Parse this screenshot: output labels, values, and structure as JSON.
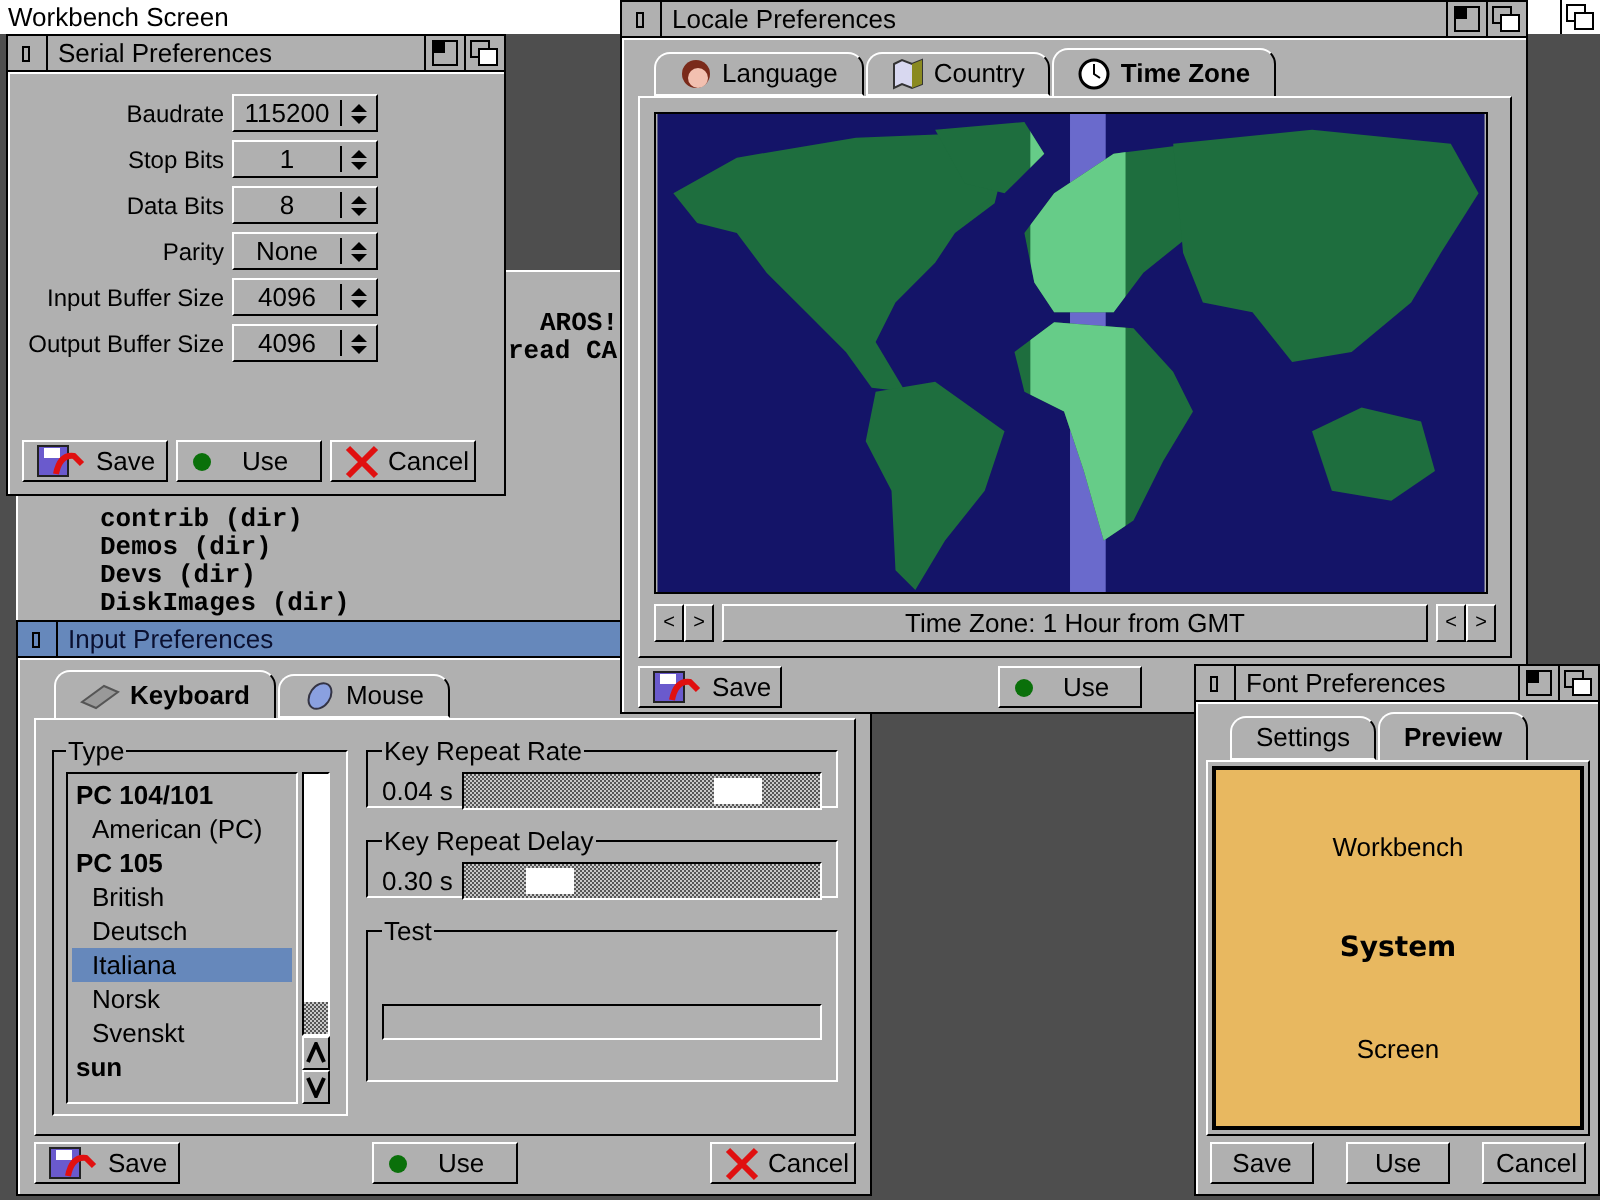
{
  "screen": {
    "title": "Workbench Screen"
  },
  "shell": {
    "lines_right": [
      "AROS!",
      "read CA"
    ],
    "lines": [
      "contrib (dir)",
      "Demos (dir)",
      "Devs (dir)",
      "DiskImages (dir)"
    ]
  },
  "serial": {
    "title": "Serial Preferences",
    "active": false,
    "fields": [
      {
        "label": "Baudrate",
        "value": "115200"
      },
      {
        "label": "Stop Bits",
        "value": "1"
      },
      {
        "label": "Data Bits",
        "value": "8"
      },
      {
        "label": "Parity",
        "value": "None"
      },
      {
        "label": "Input Buffer Size",
        "value": "4096"
      },
      {
        "label": "Output Buffer Size",
        "value": "4096"
      }
    ],
    "buttons": [
      {
        "kind": "save",
        "label": "Save"
      },
      {
        "kind": "use",
        "label": "Use"
      },
      {
        "kind": "cancel",
        "label": "Cancel"
      }
    ]
  },
  "locale": {
    "title": "Locale Preferences",
    "active": false,
    "tabs": [
      {
        "kind": "language",
        "label": "Language",
        "selected": false
      },
      {
        "kind": "country",
        "label": "Country",
        "selected": false
      },
      {
        "kind": "clock",
        "label": "Time Zone",
        "selected": true
      }
    ],
    "nav_left": [
      "<",
      ">"
    ],
    "status": "Time Zone: 1 Hour from GMT",
    "nav_right": [
      "<",
      ">"
    ],
    "buttons": [
      {
        "kind": "save",
        "label": "Save"
      },
      {
        "kind": "use",
        "label": "Use"
      }
    ]
  },
  "input": {
    "title": "Input Preferences",
    "active": true,
    "tabs": [
      {
        "kind": "keyboard",
        "label": "Keyboard",
        "selected": true
      },
      {
        "kind": "mouse",
        "label": "Mouse",
        "selected": false
      }
    ],
    "type_title": "Type",
    "layouts": [
      {
        "kind": "group",
        "label": "PC 104/101",
        "selected": false
      },
      {
        "kind": "item",
        "label": "American (PC)",
        "selected": false
      },
      {
        "kind": "group",
        "label": "PC 105",
        "selected": false
      },
      {
        "kind": "item",
        "label": "British",
        "selected": false
      },
      {
        "kind": "item",
        "label": "Deutsch",
        "selected": false
      },
      {
        "kind": "item",
        "label": "Italiana",
        "selected": true
      },
      {
        "kind": "item",
        "label": "Norsk",
        "selected": false
      },
      {
        "kind": "item",
        "label": "Svenskt",
        "selected": false
      },
      {
        "kind": "group",
        "label": "sun",
        "selected": false
      }
    ],
    "sliders": [
      {
        "title": "Key Repeat Rate",
        "reading": "0.04 s",
        "level": 0.82
      },
      {
        "title": "Key Repeat Delay",
        "reading": "0.30 s",
        "level": 0.19
      }
    ],
    "test_title": "Test",
    "buttons": [
      {
        "kind": "save",
        "label": "Save"
      },
      {
        "kind": "use",
        "label": "Use"
      },
      {
        "kind": "cancel",
        "label": "Cancel"
      }
    ]
  },
  "font": {
    "title": "Font Preferences",
    "active": false,
    "tabs": [
      {
        "label": "Settings",
        "selected": false
      },
      {
        "label": "Preview",
        "selected": true
      }
    ],
    "preview": [
      {
        "kind": "plain",
        "text": "Workbench"
      },
      {
        "kind": "bold",
        "text": "System"
      },
      {
        "kind": "plain",
        "text": "Screen"
      }
    ],
    "buttons": [
      {
        "label": "Save"
      },
      {
        "label": "Use"
      },
      {
        "label": "Cancel"
      }
    ]
  }
}
